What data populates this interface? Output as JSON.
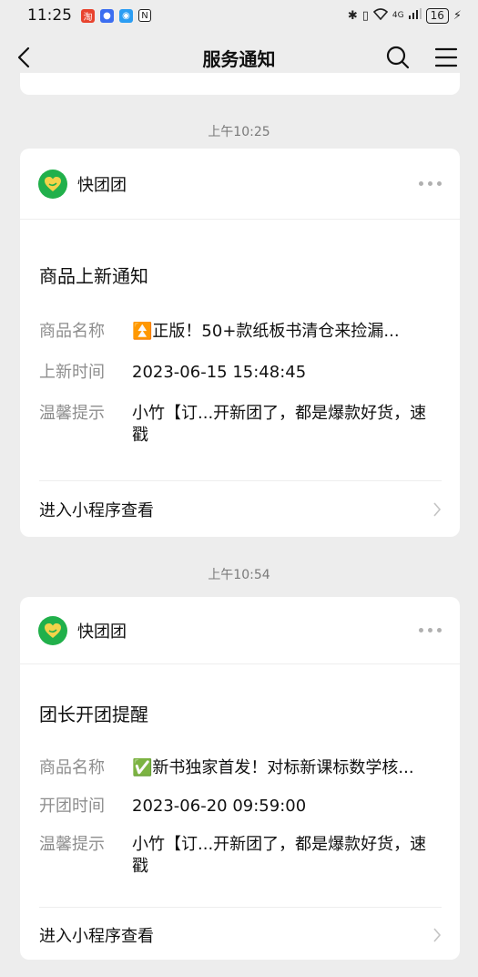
{
  "status_bar": {
    "time": "11:25",
    "network": "4G",
    "battery": "16"
  },
  "nav": {
    "title": "服务通知"
  },
  "notifications": [
    {
      "time": "上午10:25",
      "app_name": "快团团",
      "title": "商品上新通知",
      "fields": [
        {
          "label": "商品名称",
          "value": "⏫正版！50+款纸板书清仓来捡漏..."
        },
        {
          "label": "上新时间",
          "value": "2023-06-15 15:48:45"
        },
        {
          "label": "温馨提示",
          "value": "小竹【订...开新团了，都是爆款好货，速戳"
        }
      ],
      "footer": "进入小程序查看"
    },
    {
      "time": "上午10:54",
      "app_name": "快团团",
      "title": "团长开团提醒",
      "fields": [
        {
          "label": "商品名称",
          "value": "✅新书独家首发！对标新课标数学核..."
        },
        {
          "label": "开团时间",
          "value": "2023-06-20 09:59:00"
        },
        {
          "label": "温馨提示",
          "value": "小竹【订...开新团了，都是爆款好货，速戳"
        }
      ],
      "footer": "进入小程序查看"
    }
  ]
}
